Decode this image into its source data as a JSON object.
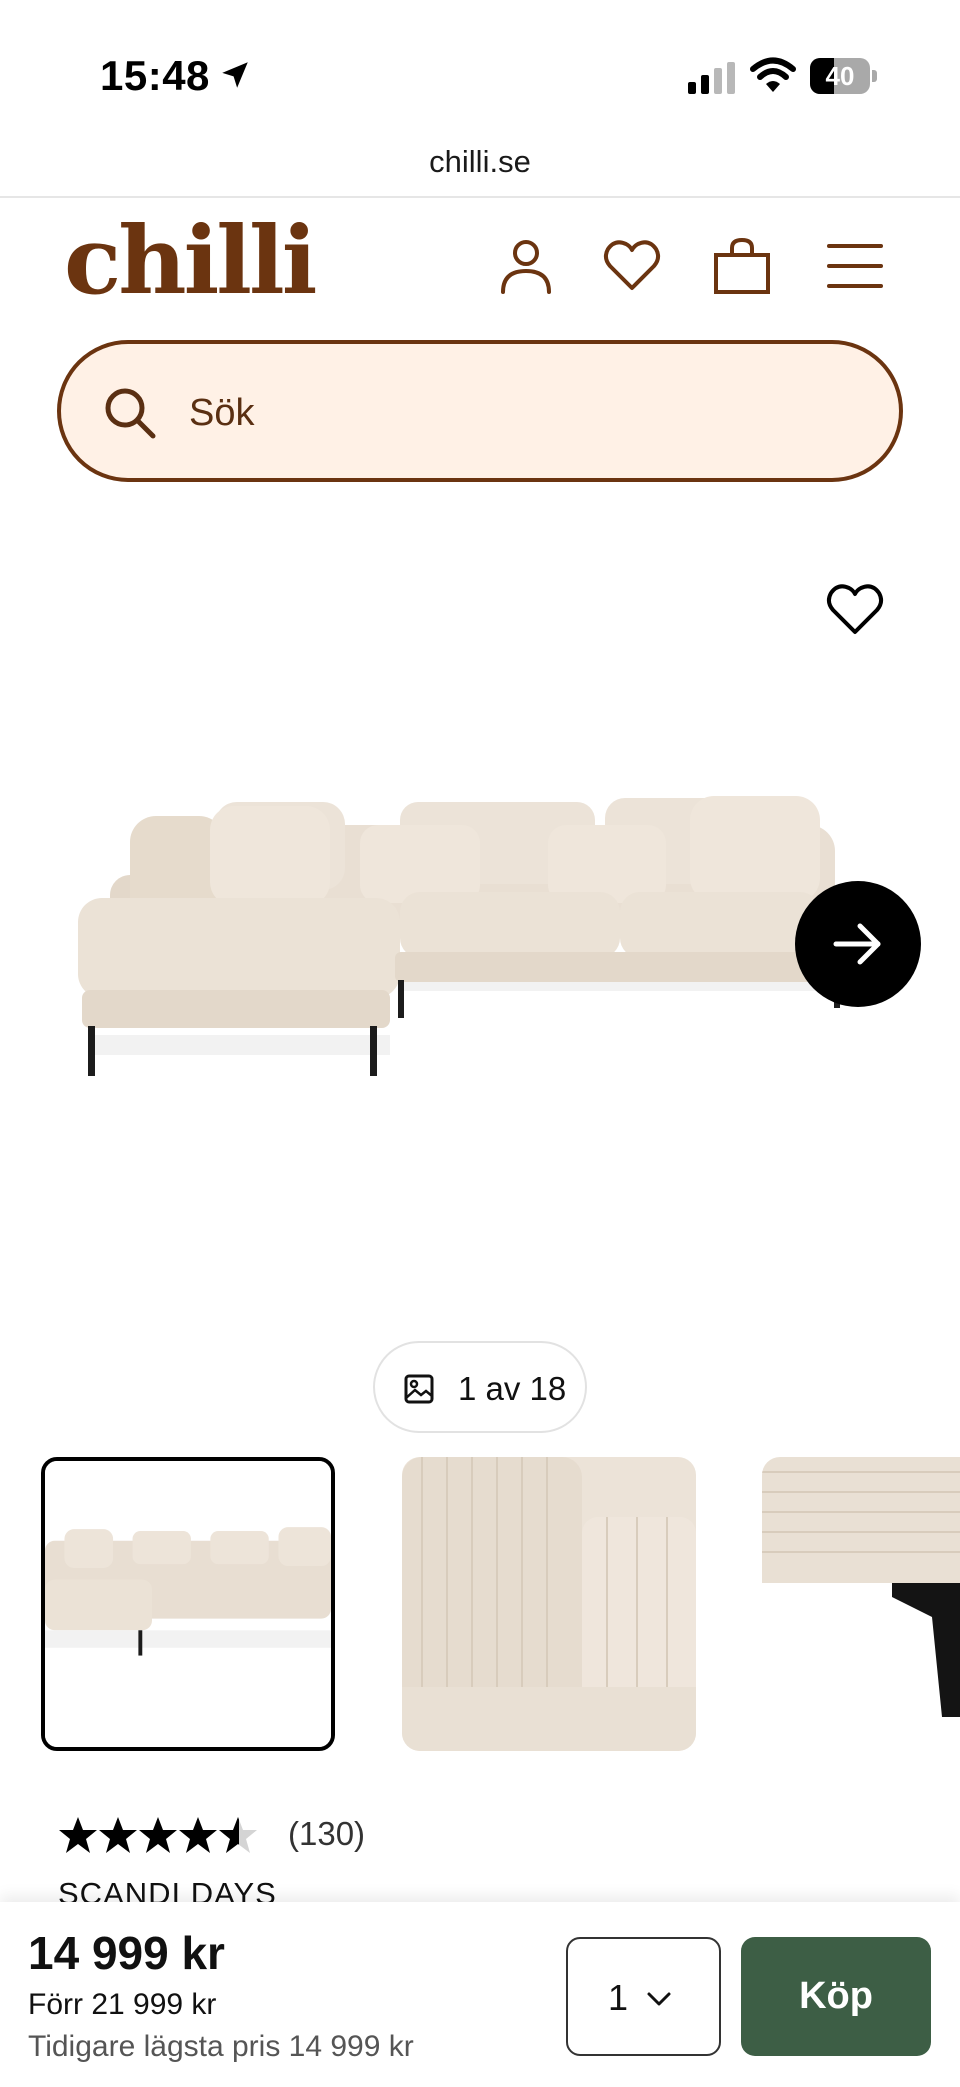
{
  "status_bar": {
    "time": "15:48",
    "battery": "40",
    "battery_level": 0.4
  },
  "browser": {
    "url": "chilli.se"
  },
  "header": {
    "logo": "chilli",
    "icons": [
      "account-icon",
      "heart-icon",
      "shopping-bag-icon",
      "menu-icon"
    ]
  },
  "search": {
    "placeholder": "Sök"
  },
  "gallery": {
    "counter": "1 av 18"
  },
  "product": {
    "rating": 4.5,
    "rating_count": "(130)",
    "brand": "SCANDI DAYS"
  },
  "buy_bar": {
    "price": "14 999 kr",
    "before_price": "Förr 21 999 kr",
    "lowest_price": "Tidigare lägsta pris 14 999 kr",
    "quantity": "1",
    "buy_label": "Köp"
  },
  "colors": {
    "brand": "#6b3410",
    "search_bg": "#fff1e6",
    "buy_button": "#3d5e45"
  }
}
